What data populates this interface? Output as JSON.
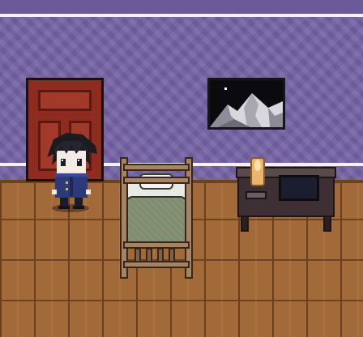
{
  "scene": {
    "type": "top-down pixel-art room",
    "colors": {
      "wall": "#7462a6",
      "rail": "#f4f2f7",
      "floor": "#a36a39",
      "door": "#8e2c20",
      "blanket": "#7e8b6c",
      "desk": "#3d2f33",
      "player_hair": "#1c1b22",
      "player_coat": "#2d3a7a"
    }
  },
  "objects": {
    "door": "door-icon",
    "painting": "mountain-painting-icon",
    "bed": "bed-icon",
    "desk": "desk-icon",
    "candle": "candle-icon",
    "monitor": "monitor-icon",
    "player": "player-character-sprite"
  }
}
